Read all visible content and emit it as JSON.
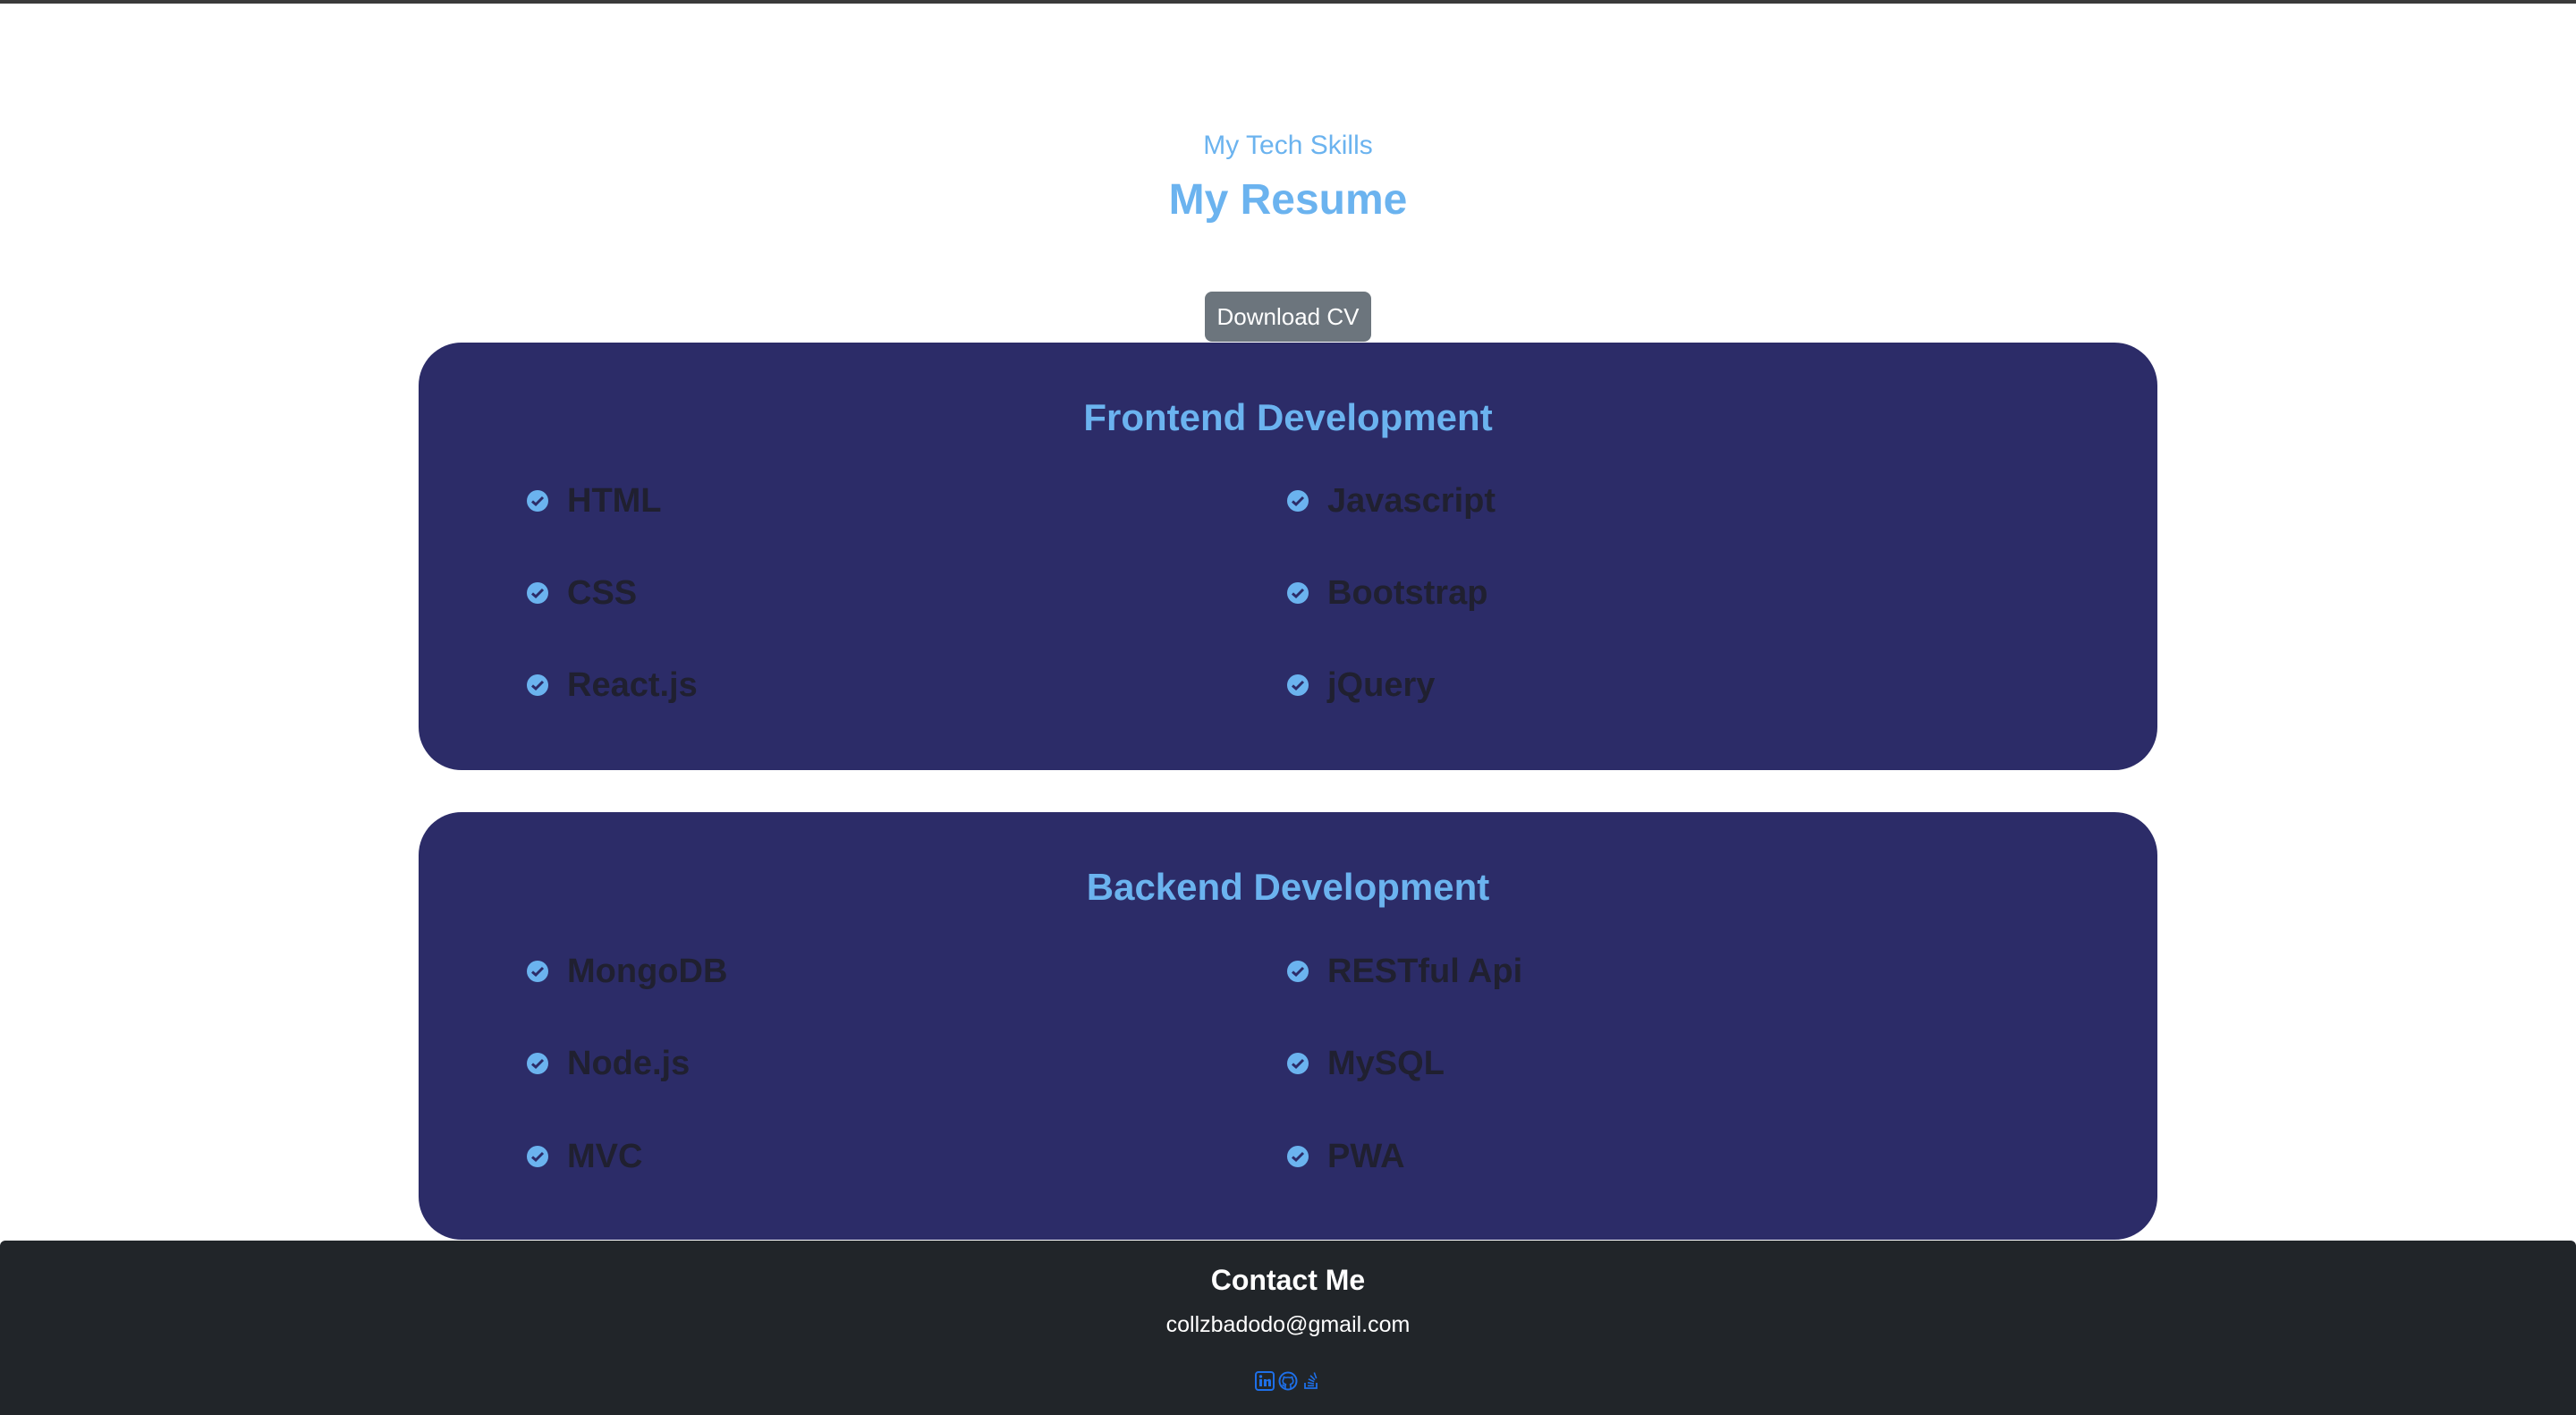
{
  "header": {
    "subtitle": "My Tech Skills",
    "title": "My Resume",
    "download_label": "Download CV"
  },
  "sections": [
    {
      "title": "Frontend Development",
      "skills": [
        "HTML",
        "Javascript",
        "CSS",
        "Bootstrap",
        "React.js",
        "jQuery"
      ]
    },
    {
      "title": "Backend Development",
      "skills": [
        "MongoDB",
        "RESTful Api",
        "Node.js",
        "MySQL",
        "MVC",
        "PWA"
      ]
    }
  ],
  "footer": {
    "title": "Contact Me",
    "email": "collzbadodo@gmail.com",
    "socials": [
      "linkedin-icon",
      "github-icon",
      "stackoverflow-icon"
    ]
  },
  "colors": {
    "accent": "#6bb3ef",
    "card_bg": "#2c2c68",
    "footer_bg": "#212529",
    "button_bg": "#6c757d",
    "icon_blue": "#1e6fe8"
  }
}
